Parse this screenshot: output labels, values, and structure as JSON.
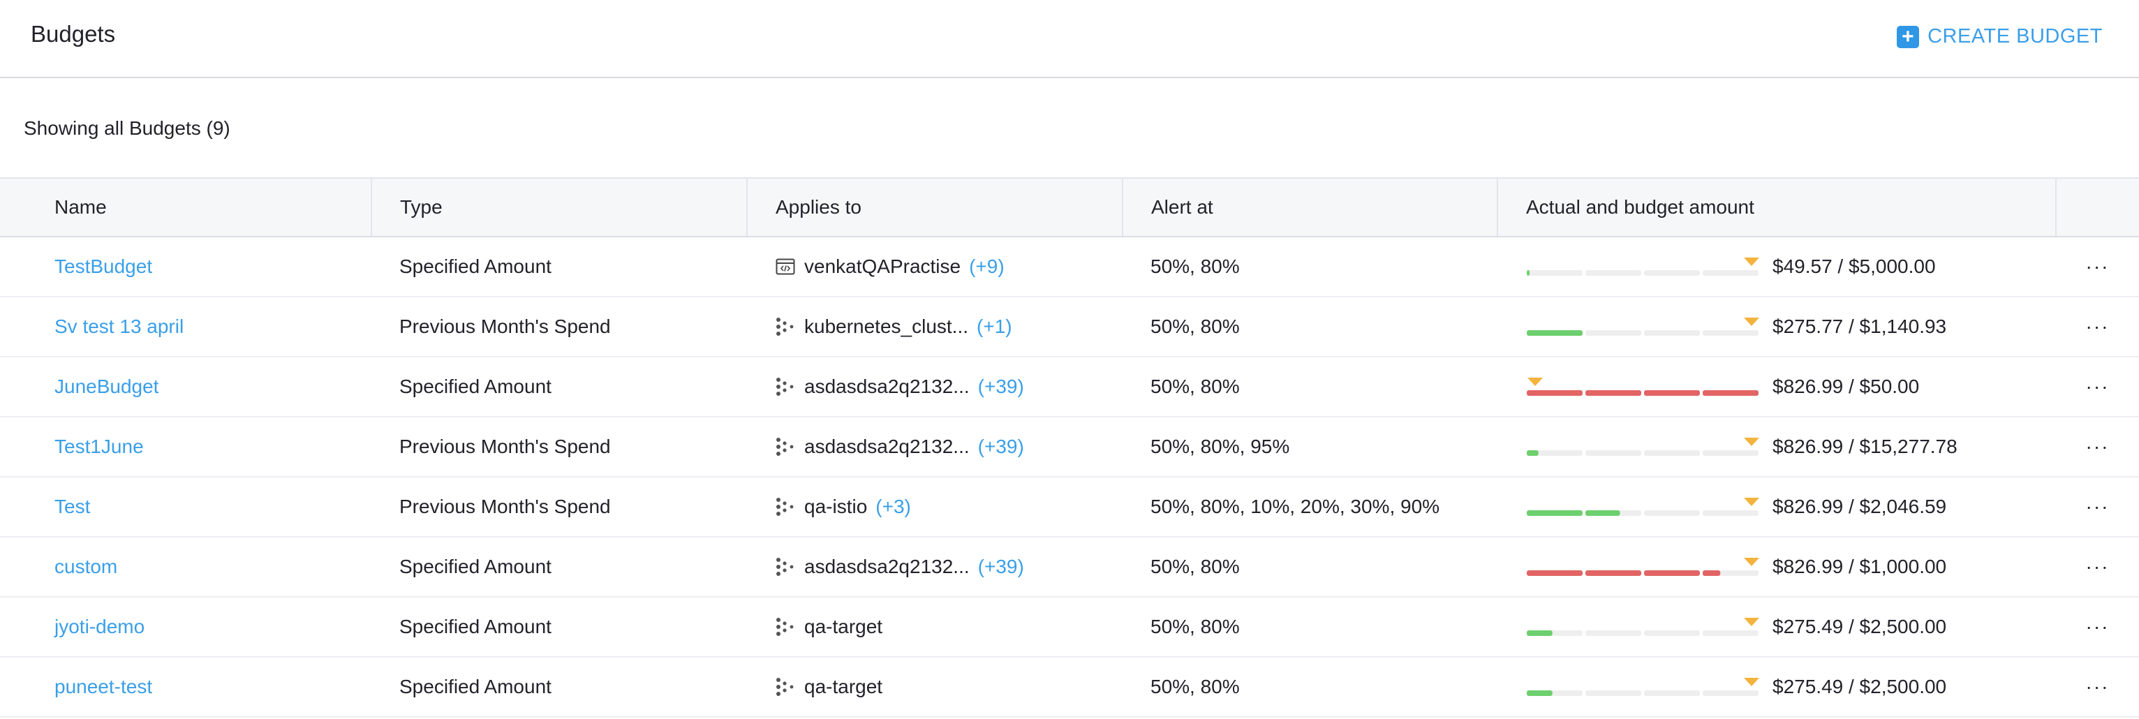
{
  "header": {
    "title": "Budgets",
    "create_button_label": "CREATE BUDGET",
    "create_icon": "plus-square-icon"
  },
  "summary": {
    "showing_text": "Showing all Budgets (9)"
  },
  "colors": {
    "accent": "#3a9fe8",
    "bar_ok": "#6dcf6d",
    "bar_over": "#e26464",
    "bar_track": "#eeeeee",
    "alert_marker": "#f3b33d"
  },
  "table": {
    "columns": [
      "Name",
      "Type",
      "Applies to",
      "Alert at",
      "Actual and budget amount",
      ""
    ],
    "rows": [
      {
        "name": "TestBudget",
        "type": "Specified Amount",
        "applies_icon": "application-icon",
        "applies_to": "venkatQAPractise",
        "applies_more": "(+9)",
        "alert_at": "50%, 80%",
        "amount": "$49.57 / $5,000.00",
        "spend_fraction": 0.01,
        "over_budget": false
      },
      {
        "name": "Sv test 13 april",
        "type": "Previous Month's Spend",
        "applies_icon": "cluster-icon",
        "applies_to": "kubernetes_clust...",
        "applies_more": "(+1)",
        "alert_at": "50%, 80%",
        "amount": "$275.77 / $1,140.93",
        "spend_fraction": 0.24,
        "over_budget": false
      },
      {
        "name": "JuneBudget",
        "type": "Specified Amount",
        "applies_icon": "cluster-icon",
        "applies_to": "asdasdsa2q2132...",
        "applies_more": "(+39)",
        "alert_at": "50%, 80%",
        "amount": "$826.99 / $50.00",
        "spend_fraction": 1.0,
        "over_budget": true
      },
      {
        "name": "Test1June",
        "type": "Previous Month's Spend",
        "applies_icon": "cluster-icon",
        "applies_to": "asdasdsa2q2132...",
        "applies_more": "(+39)",
        "alert_at": "50%, 80%, 95%",
        "amount": "$826.99 / $15,277.78",
        "spend_fraction": 0.05,
        "over_budget": false
      },
      {
        "name": "Test",
        "type": "Previous Month's Spend",
        "applies_icon": "cluster-icon",
        "applies_to": "qa-istio",
        "applies_more": "(+3)",
        "alert_at": "50%, 80%, 10%, 20%, 30%, 90%",
        "amount": "$826.99 / $2,046.59",
        "spend_fraction": 0.4,
        "over_budget": false
      },
      {
        "name": "custom",
        "type": "Specified Amount",
        "applies_icon": "cluster-icon",
        "applies_to": "asdasdsa2q2132...",
        "applies_more": "(+39)",
        "alert_at": "50%, 80%",
        "amount": "$826.99 / $1,000.00",
        "spend_fraction": 0.83,
        "over_budget": true
      },
      {
        "name": "jyoti-demo",
        "type": "Specified Amount",
        "applies_icon": "cluster-icon",
        "applies_to": "qa-target",
        "applies_more": "",
        "alert_at": "50%, 80%",
        "amount": "$275.49 / $2,500.00",
        "spend_fraction": 0.11,
        "over_budget": false
      },
      {
        "name": "puneet-test",
        "type": "Specified Amount",
        "applies_icon": "cluster-icon",
        "applies_to": "qa-target",
        "applies_more": "",
        "alert_at": "50%, 80%",
        "amount": "$275.49 / $2,500.00",
        "spend_fraction": 0.11,
        "over_budget": false
      }
    ],
    "row_menu_label": "···"
  }
}
